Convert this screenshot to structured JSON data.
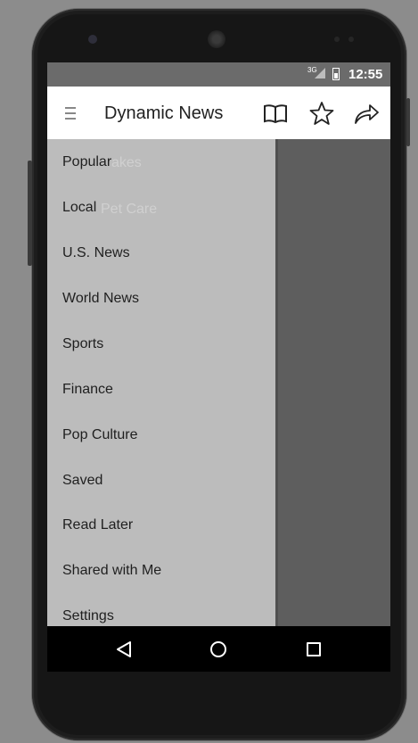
{
  "status_bar": {
    "network": "3G",
    "time": "12:55"
  },
  "app_bar": {
    "title": "Dynamic News",
    "icons": [
      "menu-icon",
      "book-icon",
      "star-icon",
      "share-icon"
    ]
  },
  "background_list": {
    "items": [
      "akes",
      "Pet Care"
    ]
  },
  "drawer": {
    "items": [
      {
        "label": "Popular"
      },
      {
        "label": "Local"
      },
      {
        "label": "U.S. News"
      },
      {
        "label": "World News"
      },
      {
        "label": "Sports"
      },
      {
        "label": "Finance"
      },
      {
        "label": "Pop Culture"
      },
      {
        "label": "Saved"
      },
      {
        "label": "Read Later"
      },
      {
        "label": "Shared with Me"
      },
      {
        "label": "Settings"
      }
    ]
  },
  "nav_bar": {
    "buttons": [
      "back-icon",
      "home-icon",
      "recents-icon"
    ]
  },
  "colors": {
    "app_bar": "#ffffff",
    "drawer": "#bcbcbc",
    "scrim": "#5e5e5e",
    "nav_bar": "#000000"
  }
}
